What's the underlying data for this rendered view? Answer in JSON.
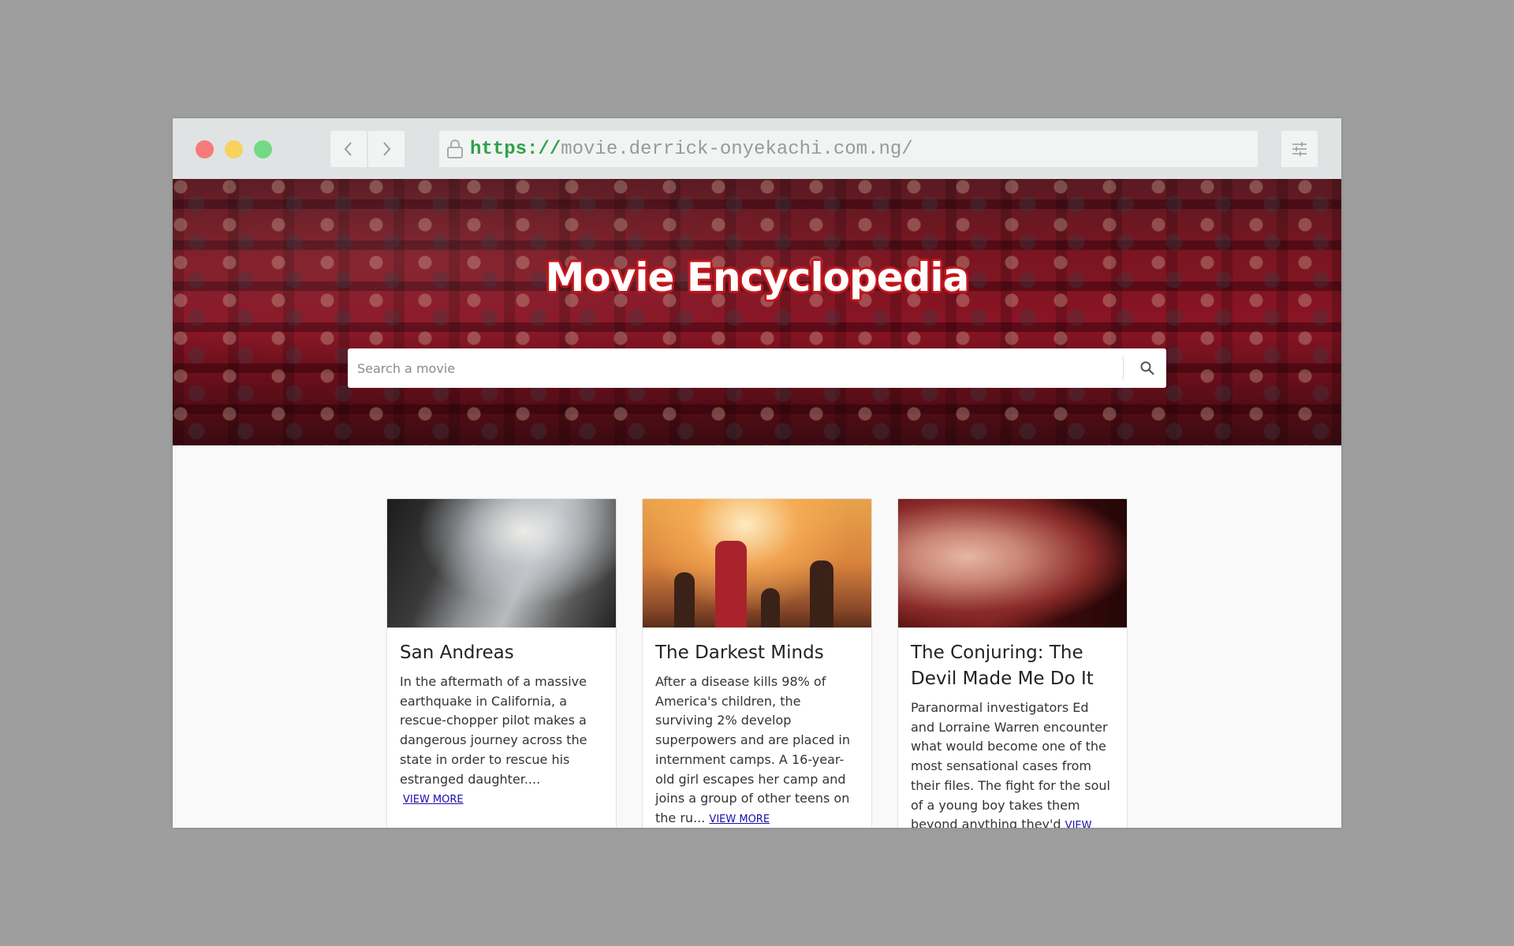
{
  "browser": {
    "url_scheme": "https://",
    "url_host": "movie.derrick-onyekachi.com.ng/"
  },
  "hero": {
    "title": "Movie Encyclopedia",
    "search_placeholder": "Search a movie"
  },
  "movies": [
    {
      "title": "San Andreas",
      "overview": "In the aftermath of a massive earthquake in California, a rescue-chopper pilot makes a dangerous journey across the state in order to rescue his estranged daughter....",
      "link": "VIEW MORE"
    },
    {
      "title": "The Darkest Minds",
      "overview": "After a disease kills 98% of America's children, the surviving 2% develop superpowers and are placed in internment camps. A 16-year-old girl escapes her camp and joins a group of other teens on the ru...",
      "link": "VIEW MORE"
    },
    {
      "title": "The Conjuring: The Devil Made Me Do It",
      "overview": "Paranormal investigators Ed and Lorraine Warren encounter what would become one of the most sensational cases from their files. The fight for the soul of a young boy takes them beyond anything they'd",
      "link": "VIEW MORE"
    }
  ],
  "colors": {
    "url_scheme": "#2fa24a",
    "title_outline": "#c5161d",
    "link": "#1a0dab"
  }
}
